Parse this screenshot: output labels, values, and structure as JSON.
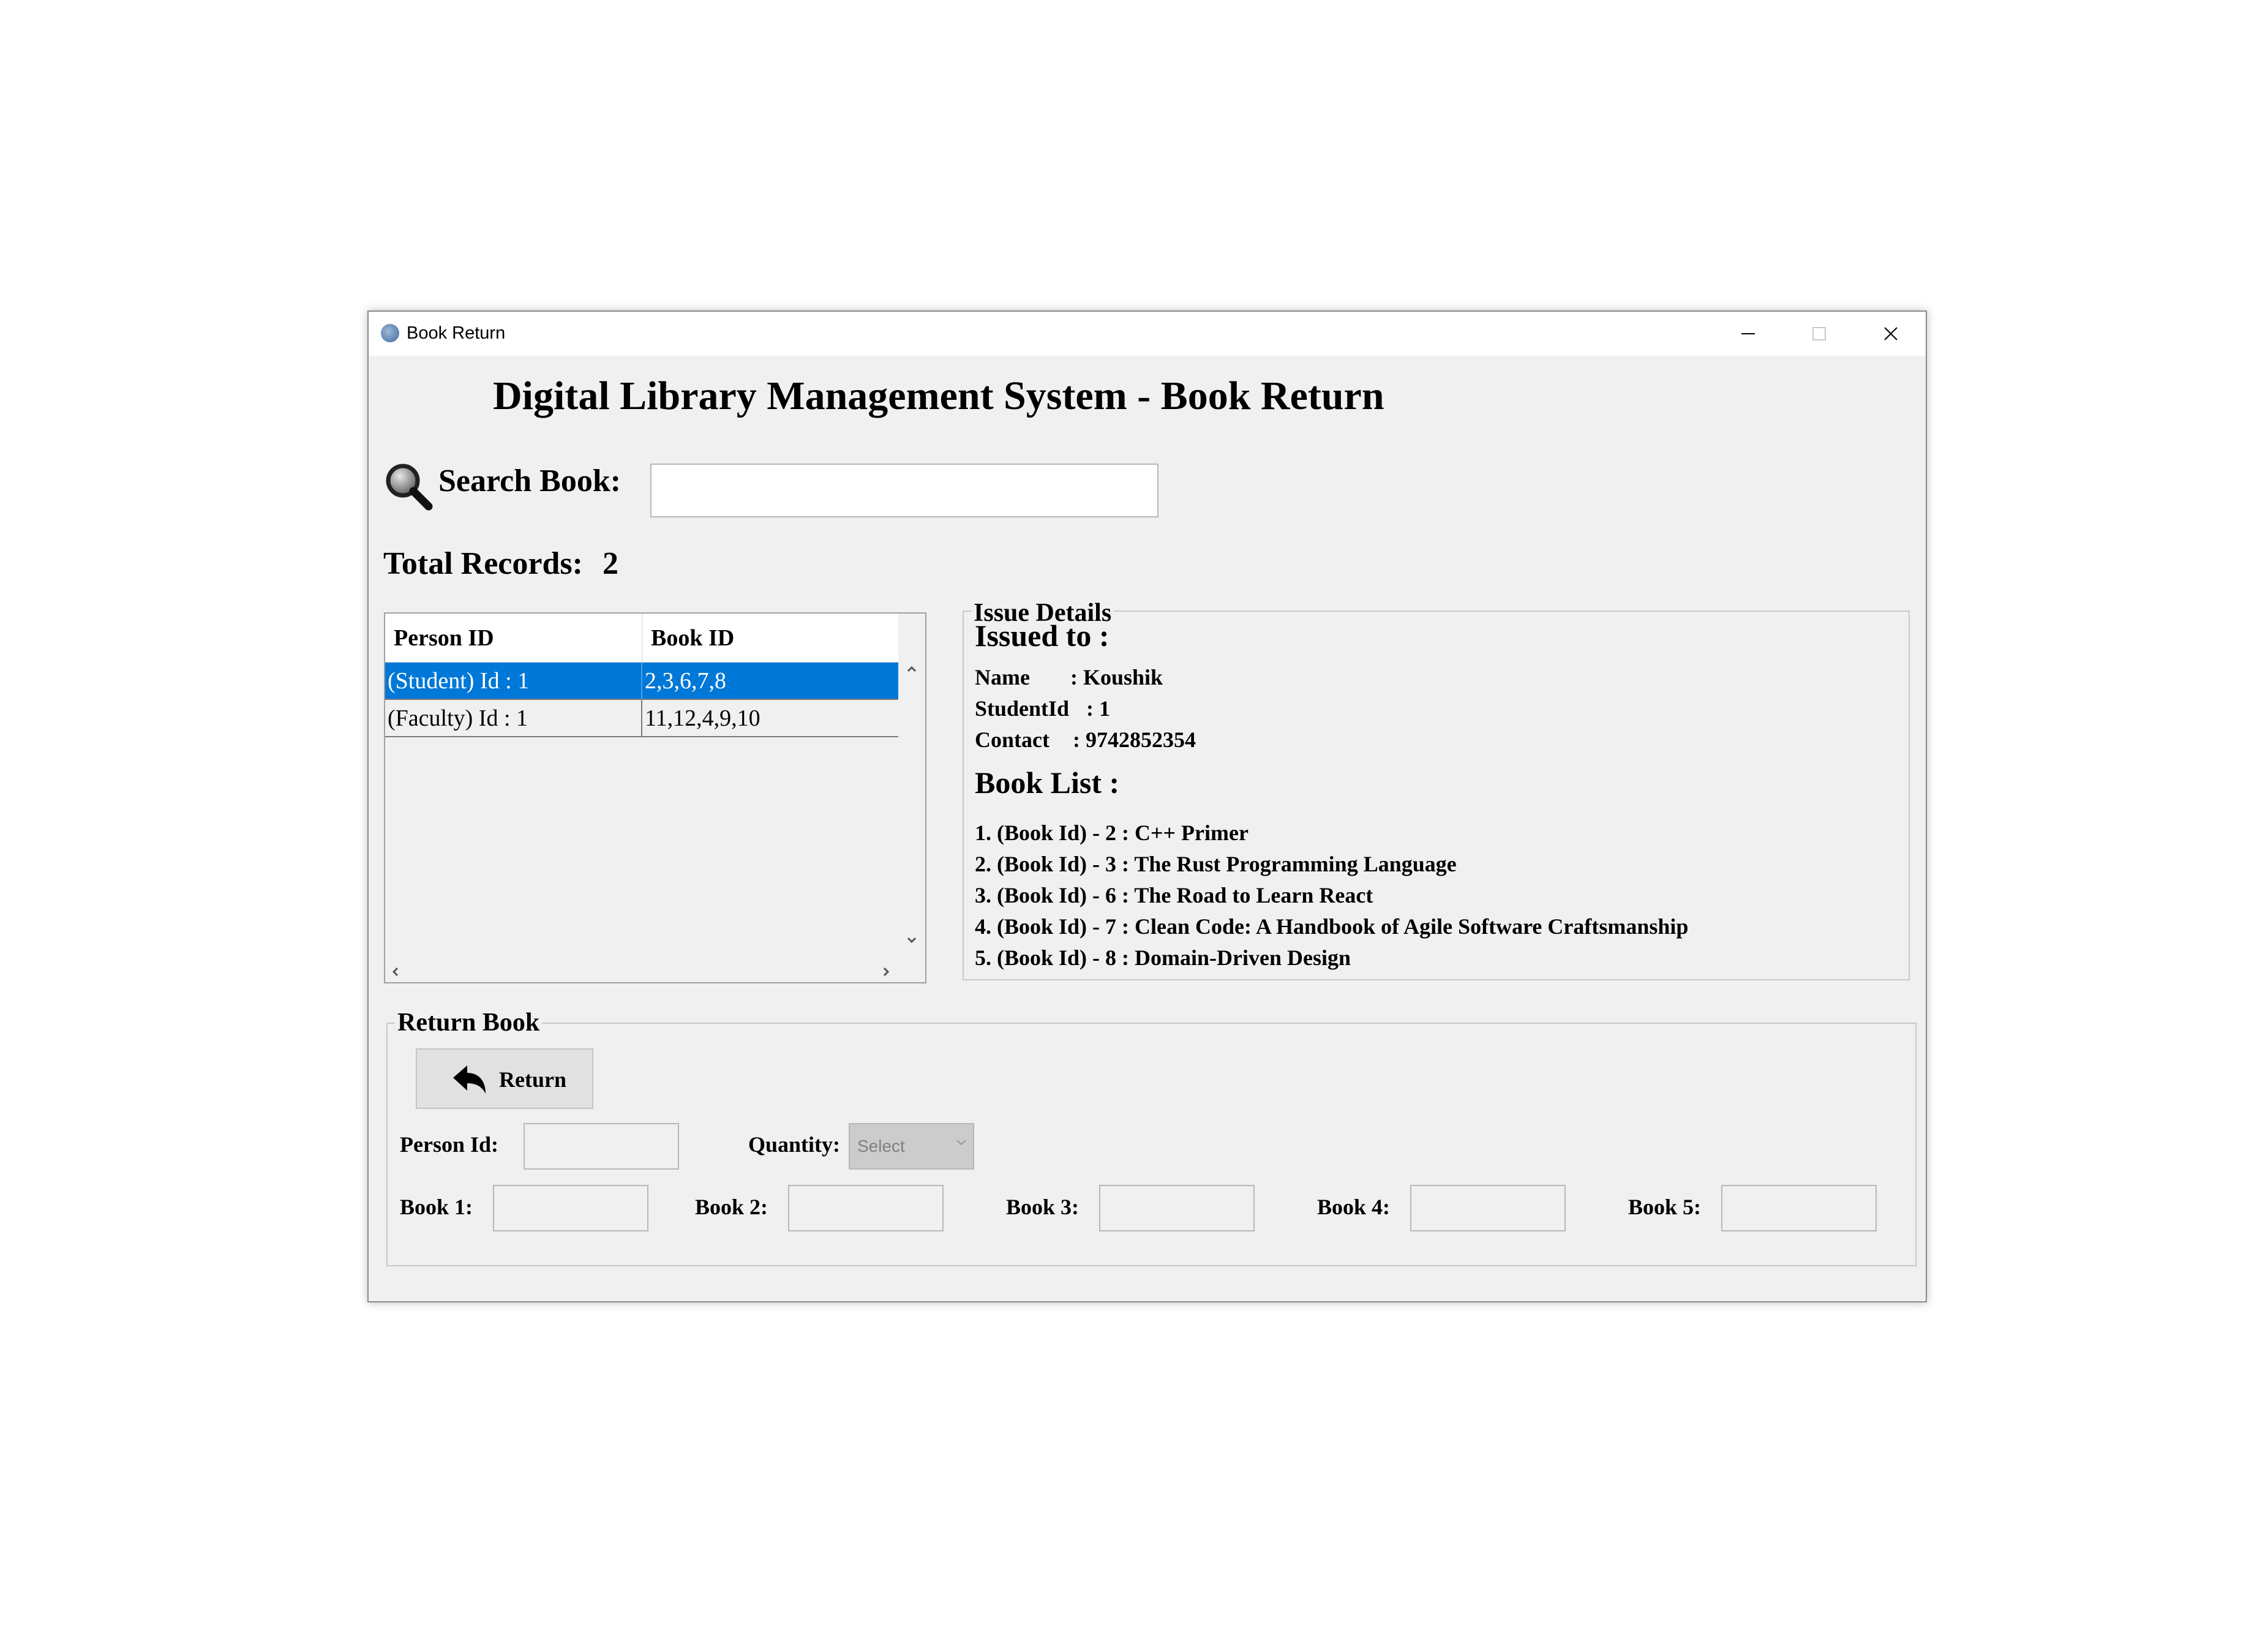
{
  "window": {
    "title": "Book Return",
    "buttons": {
      "minimize": "minimize-icon",
      "maximize": "maximize-icon",
      "close": "close-icon"
    }
  },
  "header": {
    "title": "Digital Library Management System - Book Return"
  },
  "search": {
    "label": "Search Book:",
    "value": "",
    "icon": "search-icon"
  },
  "records": {
    "label": "Total Records:",
    "count": "2"
  },
  "table": {
    "columns": [
      "Person ID",
      "Book ID"
    ],
    "rows": [
      {
        "person": "(Student) Id : 1",
        "books": "2,3,6,7,8",
        "selected": true
      },
      {
        "person": "(Faculty) Id : 1",
        "books": "11,12,4,9,10",
        "selected": false
      }
    ]
  },
  "issue_details": {
    "legend": "Issue Details",
    "issued_to": "Issued to :",
    "name_label": "Name",
    "name_value": ": Koushik",
    "id_label": "StudentId",
    "id_value": ": 1",
    "contact_label": "Contact",
    "contact_value": ": 9742852354",
    "book_list_heading": "Book List :",
    "books": [
      "1. (Book Id) - 2 : C++ Primer",
      "2. (Book Id) - 3 : The Rust Programming Language",
      "3. (Book Id) - 6 : The Road to Learn React",
      "4. (Book Id) - 7 : Clean Code: A Handbook of Agile Software Craftsmanship",
      "5. (Book Id) - 8 : Domain-Driven Design"
    ]
  },
  "return_book": {
    "legend": "Return Book",
    "button_label": "Return",
    "button_icon": "reply-arrow-icon",
    "person_id_label": "Person Id:",
    "quantity_label": "Quantity:",
    "quantity_value": "Select",
    "book_labels": [
      "Book 1:",
      "Book 2:",
      "Book 3:",
      "Book 4:",
      "Book 5:"
    ]
  }
}
